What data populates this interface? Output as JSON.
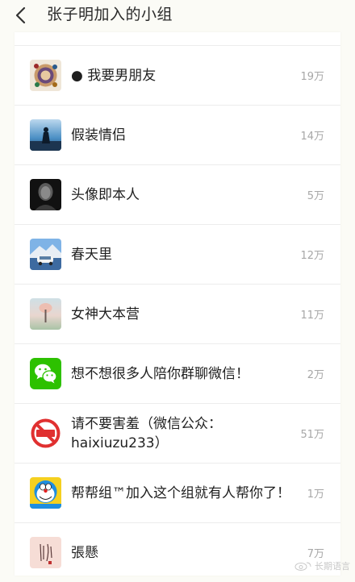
{
  "header": {
    "title": "张子明加入的小组"
  },
  "groups": [
    {
      "name": "● 我要男朋友",
      "count": "19万",
      "avatar": "ornate-pattern-avatar"
    },
    {
      "name": "假装情侣",
      "count": "14万",
      "avatar": "couple-silhouette-avatar"
    },
    {
      "name": "头像即本人",
      "count": "5万",
      "avatar": "dark-portrait-avatar"
    },
    {
      "name": "春天里",
      "count": "12万",
      "avatar": "mountain-car-avatar"
    },
    {
      "name": "女神大本营",
      "count": "11万",
      "avatar": "soft-sky-avatar"
    },
    {
      "name": "想不想很多人陪你群聊微信！",
      "count": "2万",
      "avatar": "wechat-icon"
    },
    {
      "name": "请不要害羞（微信公众：haixiuzu233）",
      "count": "51万",
      "avatar": "no-shy-sign-avatar"
    },
    {
      "name": "帮帮组™加入这个组就有人帮你了！",
      "count": "1万",
      "avatar": "doraemon-avatar"
    },
    {
      "name": "張懸",
      "count": "7万",
      "avatar": "calligraphy-avatar"
    }
  ],
  "watermark": {
    "text": "长期语言"
  },
  "colors": {
    "background": "#fbfbf6",
    "card": "#ffffff",
    "count": "#a7a7a7",
    "divider": "#ececec"
  }
}
